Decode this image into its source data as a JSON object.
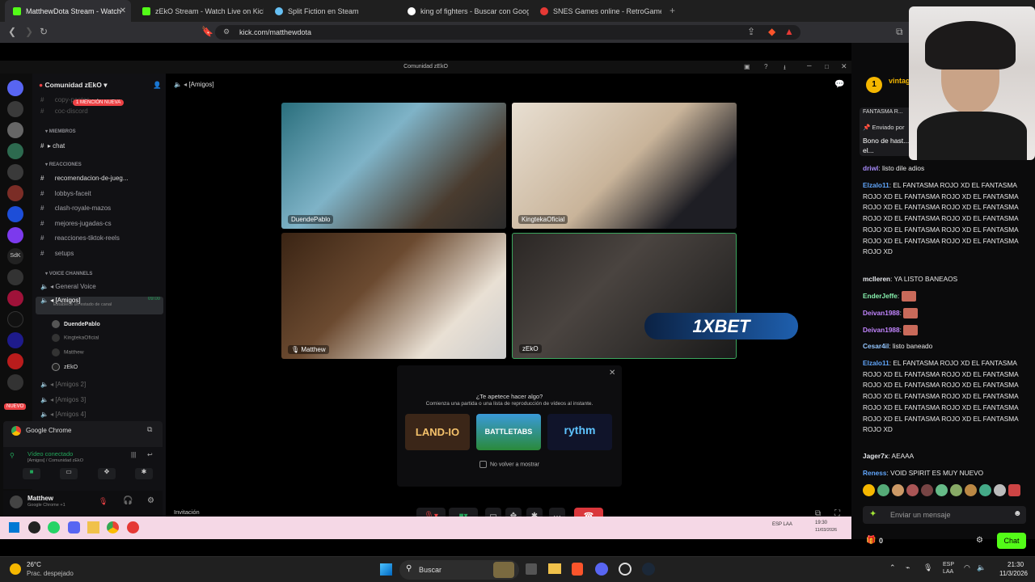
{
  "browser": {
    "tabs": [
      {
        "label": "MatthewDota Stream - Watch",
        "color": "#53fc18",
        "active": true
      },
      {
        "label": "zEkO Stream - Watch Live on Kick",
        "color": "#53fc18",
        "active": false
      },
      {
        "label": "Split Fiction en Steam",
        "color": "#66c0f4",
        "active": false
      },
      {
        "label": "king of fighters - Buscar con Google",
        "color": "#ffffff",
        "active": false
      },
      {
        "label": "SNES Games online - RetroGames.cc",
        "color": "#e53935",
        "active": false
      }
    ],
    "url": "kick.com/matthewdota"
  },
  "discord": {
    "window_title": "Comunidad zEkO",
    "server_name": "Comunidad zEkO",
    "channel_header": "[Amigos]",
    "mention_badge": "1 MENCIÓN NUEVA",
    "channels": [
      {
        "label": "copy-pastes",
        "kind": "text"
      },
      {
        "label": "coc-discord",
        "kind": "text"
      },
      {
        "label": "MIEMBROS",
        "kind": "category"
      },
      {
        "label": "chat",
        "kind": "text"
      },
      {
        "label": "REACCIONES",
        "kind": "category"
      },
      {
        "label": "recomendacion-de-jueg...",
        "kind": "text"
      },
      {
        "label": "lobbys-faceit",
        "kind": "text"
      },
      {
        "label": "clash-royale-mazos",
        "kind": "text"
      },
      {
        "label": "mejores-jugadas-cs",
        "kind": "text"
      },
      {
        "label": "reacciones-tiktok-reels",
        "kind": "text"
      },
      {
        "label": "setups",
        "kind": "text"
      },
      {
        "label": "VOICE CHANNELS",
        "kind": "category"
      },
      {
        "label": "General Voice",
        "kind": "voice"
      },
      {
        "label": "[Amigos]",
        "kind": "voice"
      }
    ],
    "voice_status": "Establece un estado de canal",
    "voice_time": "09:00",
    "voice_members": [
      "DuendePablo",
      "KingtekaOficial",
      "Matthew",
      "zEkO"
    ],
    "other_voice": [
      "[Amigos 2]",
      "[Amigos 3]",
      "[Amigos 4]"
    ],
    "server_badges": [
      "NUEVO"
    ],
    "chrome_label": "Google Chrome",
    "connection_status": "Vídeo conectado",
    "connection_sub": "[Amigos] / Comunidad zEkO",
    "user_name": "Matthew",
    "user_status": "Google Chrome +1",
    "invite_label": "Invitación",
    "participants": [
      {
        "name": "DuendePablo",
        "bg": "#4a6a7a"
      },
      {
        "name": "KingtekaOficial",
        "bg": "#c9b8a0"
      },
      {
        "name": "Matthew",
        "bg": "#5a4030"
      },
      {
        "name": "zEkO",
        "bg": "#3a3530"
      }
    ],
    "ad_text": "1XBET",
    "activity": {
      "title": "¿Te apetece hacer algo?",
      "subtitle": "Comienza una partida o una lista de reproducción de vídeos al instante.",
      "games": [
        "LAND-IO",
        "BATTLETABS",
        "rythm"
      ],
      "checkbox_label": "No volver a mostrar"
    },
    "clock": {
      "time": "19:30",
      "date": "11/03/2026",
      "lang": "ESP LAA"
    }
  },
  "kick_chat": {
    "rank": "1",
    "top_user": "vintag",
    "pinned_partial": "FANTASMA R...",
    "pinned_by": "Enviado por",
    "pinned_text": "Bono de hast... promocional GOTTO1X si sigue el...",
    "messages": [
      {
        "user": "driwl",
        "color": "#a78bfa",
        "text": "listo dile adios"
      },
      {
        "user": "Elzalo11",
        "color": "#60a5fa",
        "text": "EL FANTASMA ROJO XD EL FANTASMA ROJO XD EL FANTASMA ROJO XD EL FANTASMA ROJO XD EL FANTASMA ROJO XD EL FANTASMA ROJO XD EL FANTASMA ROJO XD EL FANTASMA ROJO XD EL FANTASMA ROJO XD EL FANTASMA ROJO XD EL FANTASMA ROJO XD EL FANTASMA ROJO XD"
      },
      {
        "user": "mclleren",
        "color": "#e5e7eb",
        "text": "YA LISTO BANEAOS"
      },
      {
        "user": "EnderJeffe",
        "color": "#86efac",
        "text": ""
      },
      {
        "user": "Deivan1988",
        "color": "#c084fc",
        "text": ""
      },
      {
        "user": "Deivan1988",
        "color": "#c084fc",
        "text": ""
      },
      {
        "user": "Cesar4il",
        "color": "#93c5fd",
        "text": "listo baneado"
      },
      {
        "user": "Elzalo11",
        "color": "#60a5fa",
        "text": "EL FANTASMA ROJO XD EL FANTASMA ROJO XD EL FANTASMA ROJO XD EL FANTASMA ROJO XD EL FANTASMA ROJO XD EL FANTASMA ROJO XD EL FANTASMA ROJO XD EL FANTASMA ROJO XD EL FANTASMA ROJO XD EL FANTASMA ROJO XD EL FANTASMA ROJO XD EL FANTASMA ROJO XD"
      },
      {
        "user": "Jager7x",
        "color": "#e5e7eb",
        "text": "AEAAA"
      },
      {
        "user": "Reness",
        "color": "#60a5fa",
        "text": "VOID SPIRIT ES MUY NUEVO"
      }
    ],
    "input_placeholder": "Enviar un mensaje",
    "points": "0",
    "send_label": "Chat",
    "accent": "#53fc18"
  },
  "host_taskbar": {
    "weather_temp": "26°C",
    "weather_desc": "Prac. despejado",
    "search_label": "Buscar",
    "lang": "ESP LAA",
    "time": "21:30",
    "date": "11/3/2026"
  }
}
